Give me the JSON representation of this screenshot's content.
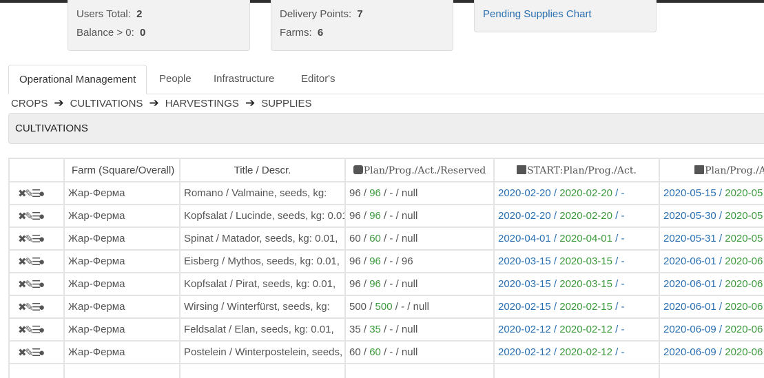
{
  "stats": {
    "users_total_label": "Users Total:",
    "users_total_value": "2",
    "balance_label": "Balance > 0:",
    "balance_value": "0",
    "delivery_points_label": "Delivery Points:",
    "delivery_points_value": "7",
    "farms_label": "Farms:",
    "farms_value": "6",
    "pending_link": "Pending Supplies Chart"
  },
  "tabs": [
    {
      "label": "Operational Management"
    },
    {
      "label": "People"
    },
    {
      "label": "Infrastructure"
    },
    {
      "label": "Editor's"
    }
  ],
  "breadcrumb": [
    "CROPS",
    "CULTIVATIONS",
    "HARVESTINGS",
    "SUPPLIES"
  ],
  "section_title": "CULTIVATIONS",
  "icons": {
    "delete": "close-icon",
    "edit": "pencil-icon",
    "list": "list-icon",
    "fruit": "apple-icon",
    "weight": "weight-icon",
    "calendar": "calendar-icon"
  },
  "colors": {
    "link": "#2a6fb0",
    "green": "#3c9a3c"
  },
  "table": {
    "headers": {
      "farm": "Farm (Square/Overall)",
      "title": "Title / Descr.",
      "plan": "Plan/Prog./Act./Reserved",
      "start": "START:Plan/Prog./Act.",
      "end": "Plan/Prog./A"
    },
    "rows": [
      {
        "farm": "Жар-Ферма",
        "title": "Romano / Valmaine, seeds, kg:",
        "plan": "96",
        "prog": "96",
        "act": "-",
        "res": "null",
        "s_plan": "2020-02-20",
        "s_prog": "2020-02-20",
        "s_act": "-",
        "e_plan": "2020-05-15",
        "e_prog": "2020-05"
      },
      {
        "farm": "Жар-Ферма",
        "title": "Kopfsalat / Lucinde, seeds, kg: 0.01,",
        "plan": "96",
        "prog": "96",
        "act": "-",
        "res": "null",
        "s_plan": "2020-02-20",
        "s_prog": "2020-02-20",
        "s_act": "-",
        "e_plan": "2020-05-30",
        "e_prog": "2020-05"
      },
      {
        "farm": "Жар-Ферма",
        "title": "Spinat / Matador, seeds, kg: 0.01,",
        "plan": "60",
        "prog": "60",
        "act": "-",
        "res": "null",
        "s_plan": "2020-04-01",
        "s_prog": "2020-04-01",
        "s_act": "-",
        "e_plan": "2020-05-31",
        "e_prog": "2020-05"
      },
      {
        "farm": "Жар-Ферма",
        "title": "Eisberg / Mythos, seeds, kg: 0.01,",
        "plan": "96",
        "prog": "96",
        "act": "-",
        "res": "96",
        "s_plan": "2020-03-15",
        "s_prog": "2020-03-15",
        "s_act": "-",
        "e_plan": "2020-06-01",
        "e_prog": "2020-06"
      },
      {
        "farm": "Жар-Ферма",
        "title": "Kopfsalat / Pirat, seeds, kg: 0.01,",
        "plan": "96",
        "prog": "96",
        "act": "-",
        "res": "null",
        "s_plan": "2020-03-15",
        "s_prog": "2020-03-15",
        "s_act": "-",
        "e_plan": "2020-06-01",
        "e_prog": "2020-06"
      },
      {
        "farm": "Жар-Ферма",
        "title": "Wirsing / Winterfürst, seeds, kg:",
        "plan": "500",
        "prog": "500",
        "act": "-",
        "res": "null",
        "s_plan": "2020-02-15",
        "s_prog": "2020-02-15",
        "s_act": "-",
        "e_plan": "2020-06-01",
        "e_prog": "2020-06"
      },
      {
        "farm": "Жар-Ферма",
        "title": "Feldsalat / Elan, seeds, kg: 0.01,",
        "plan": "35",
        "prog": "35",
        "act": "-",
        "res": "null",
        "s_plan": "2020-02-12",
        "s_prog": "2020-02-12",
        "s_act": "-",
        "e_plan": "2020-06-09",
        "e_prog": "2020-06"
      },
      {
        "farm": "Жар-Ферма",
        "title": "Postelein / Winterpostelein, seeds,",
        "plan": "60",
        "prog": "60",
        "act": "-",
        "res": "null",
        "s_plan": "2020-02-12",
        "s_prog": "2020-02-12",
        "s_act": "-",
        "e_plan": "2020-06-09",
        "e_prog": "2020-06"
      }
    ]
  }
}
